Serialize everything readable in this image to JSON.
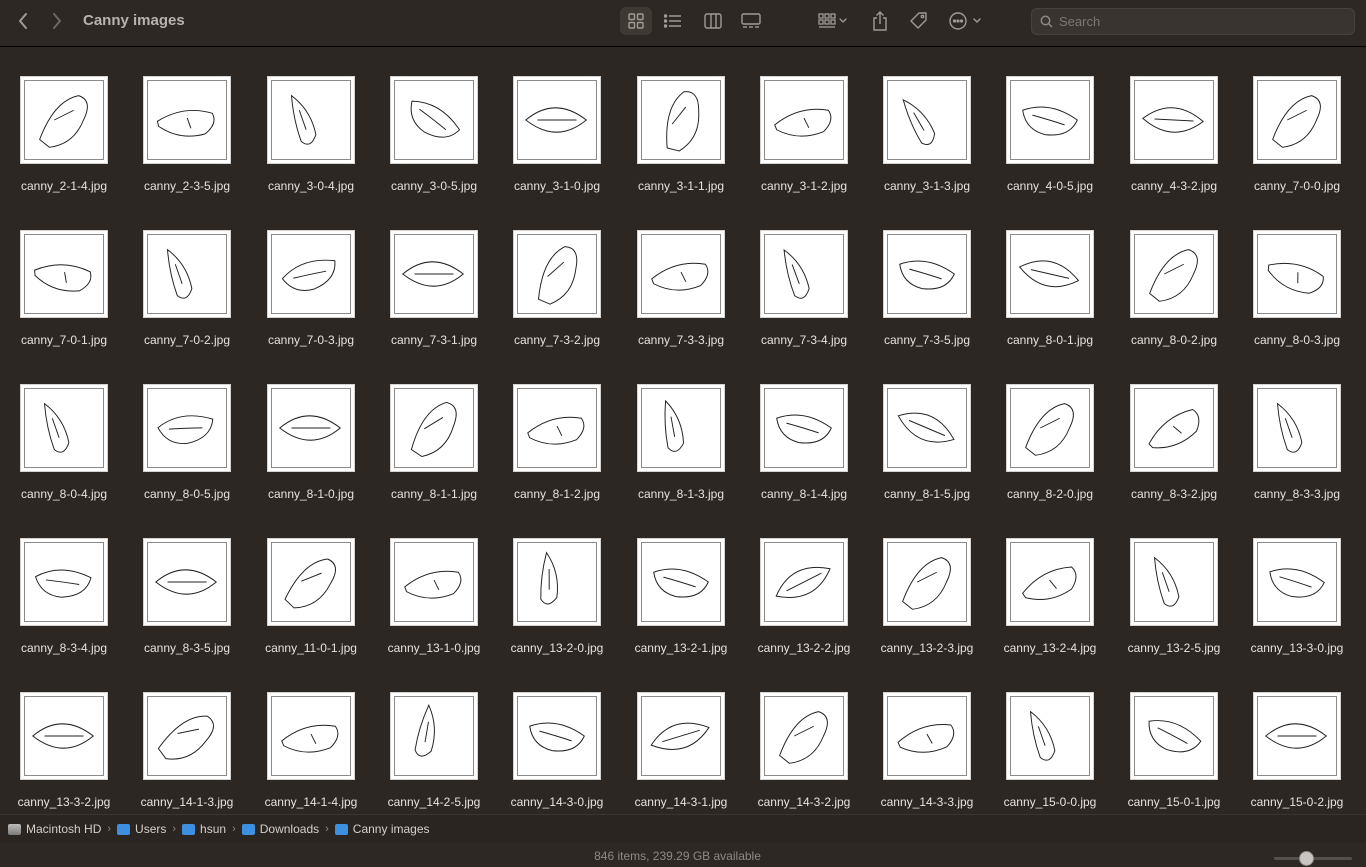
{
  "toolbar": {
    "title": "Canny images",
    "search_placeholder": "Search",
    "back_icon": "chevron-left-icon",
    "forward_icon": "chevron-right-icon"
  },
  "files": [
    "canny_2-1-4.jpg",
    "canny_2-3-5.jpg",
    "canny_3-0-4.jpg",
    "canny_3-0-5.jpg",
    "canny_3-1-0.jpg",
    "canny_3-1-1.jpg",
    "canny_3-1-2.jpg",
    "canny_3-1-3.jpg",
    "canny_4-0-5.jpg",
    "canny_4-3-2.jpg",
    "canny_7-0-0.jpg",
    "canny_7-0-1.jpg",
    "canny_7-0-2.jpg",
    "canny_7-0-3.jpg",
    "canny_7-3-1.jpg",
    "canny_7-3-2.jpg",
    "canny_7-3-3.jpg",
    "canny_7-3-4.jpg",
    "canny_7-3-5.jpg",
    "canny_8-0-1.jpg",
    "canny_8-0-2.jpg",
    "canny_8-0-3.jpg",
    "canny_8-0-4.jpg",
    "canny_8-0-5.jpg",
    "canny_8-1-0.jpg",
    "canny_8-1-1.jpg",
    "canny_8-1-2.jpg",
    "canny_8-1-3.jpg",
    "canny_8-1-4.jpg",
    "canny_8-1-5.jpg",
    "canny_8-2-0.jpg",
    "canny_8-3-2.jpg",
    "canny_8-3-3.jpg",
    "canny_8-3-4.jpg",
    "canny_8-3-5.jpg",
    "canny_11-0-1.jpg",
    "canny_13-1-0.jpg",
    "canny_13-2-0.jpg",
    "canny_13-2-1.jpg",
    "canny_13-2-2.jpg",
    "canny_13-2-3.jpg",
    "canny_13-2-4.jpg",
    "canny_13-2-5.jpg",
    "canny_13-3-0.jpg",
    "canny_13-3-2.jpg",
    "canny_14-1-3.jpg",
    "canny_14-1-4.jpg",
    "canny_14-2-5.jpg",
    "canny_14-3-0.jpg",
    "canny_14-3-1.jpg",
    "canny_14-3-2.jpg",
    "canny_14-3-3.jpg",
    "canny_15-0-0.jpg",
    "canny_15-0-1.jpg",
    "canny_15-0-2.jpg"
  ],
  "pathbar": {
    "items": [
      {
        "label": "Macintosh HD",
        "icon": "hard-drive-icon"
      },
      {
        "label": "Users",
        "icon": "folder-icon"
      },
      {
        "label": "hsun",
        "icon": "home-folder-icon"
      },
      {
        "label": "Downloads",
        "icon": "downloads-folder-icon"
      },
      {
        "label": "Canny images",
        "icon": "folder-icon"
      }
    ]
  },
  "status": {
    "text": "846 items, 239.29 GB available",
    "zoom_level": 0.4
  },
  "colors": {
    "background": "#2d2723",
    "accent": "#3d8fe0"
  }
}
